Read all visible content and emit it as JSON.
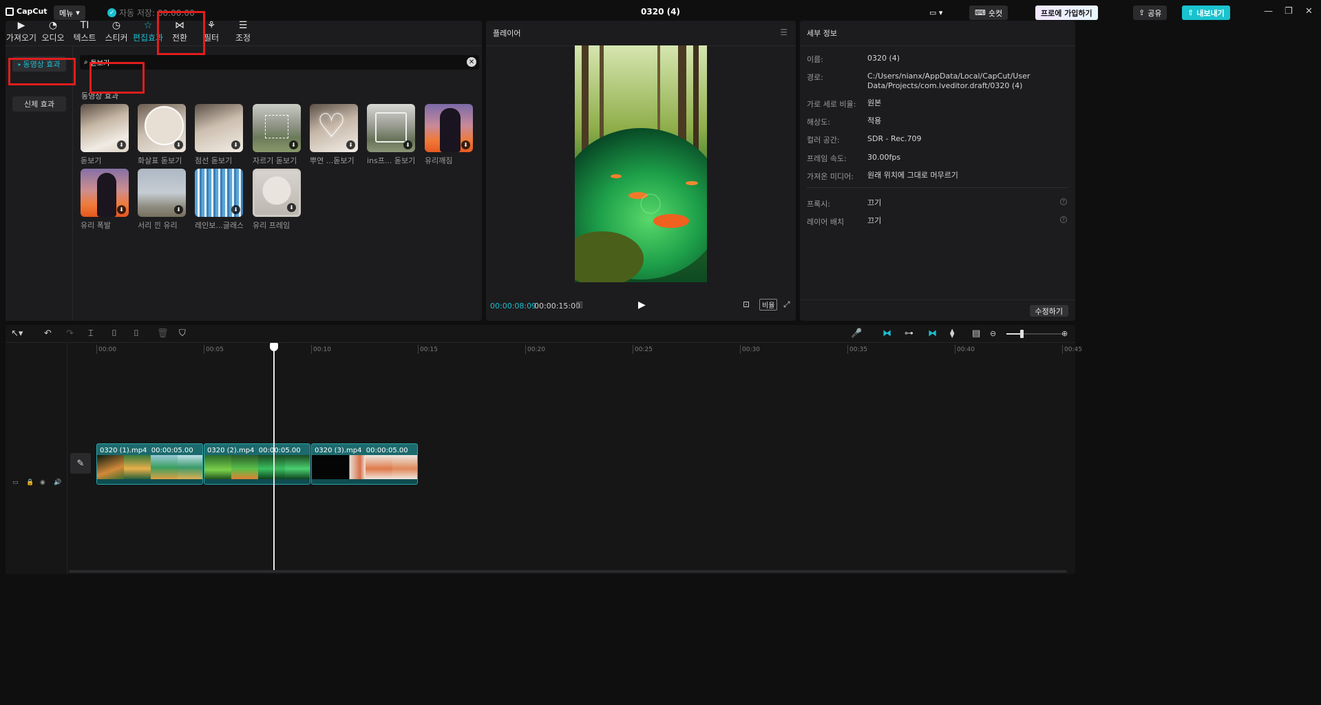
{
  "app": {
    "logo": "CapCut",
    "menu_label": "메뉴",
    "autosave": "자동 저장: 00:00:00",
    "project_title": "0320 (4)"
  },
  "titlebar": {
    "shortcut_label": "숏컷",
    "pro_label": "프로에 가입하기",
    "share_label": "공유",
    "export_label": "내보내기"
  },
  "tabs": [
    {
      "label": "가져오기",
      "icon": "import-icon"
    },
    {
      "label": "오디오",
      "icon": "audio-icon"
    },
    {
      "label": "텍스트",
      "icon": "text-icon"
    },
    {
      "label": "스티커",
      "icon": "sticker-icon"
    },
    {
      "label": "편집효과",
      "icon": "effects-icon"
    },
    {
      "label": "전환",
      "icon": "transition-icon"
    },
    {
      "label": "필터",
      "icon": "filter-icon"
    },
    {
      "label": "조정",
      "icon": "adjust-icon"
    }
  ],
  "sidebar": {
    "items": [
      {
        "label": "동영상 효과"
      },
      {
        "label": "신체 효과"
      }
    ]
  },
  "search": {
    "value": "돋보기"
  },
  "library": {
    "section_title": "동영상 효과",
    "effects": [
      {
        "label": "돋보기"
      },
      {
        "label": "화살표 돋보기"
      },
      {
        "label": "점선 돋보기"
      },
      {
        "label": "자르기 돋보기"
      },
      {
        "label": "뿌연 ...돋보기"
      },
      {
        "label": "ins프... 돋보기"
      },
      {
        "label": "유리깨짐"
      },
      {
        "label": "유리 폭발"
      },
      {
        "label": "서리 낀 유리"
      },
      {
        "label": "레인보...글래스"
      },
      {
        "label": "유리 프레임"
      }
    ]
  },
  "player": {
    "title": "플레이어",
    "current_time": "00:00:08:09",
    "duration": "00:00:15:00",
    "ratio_label": "비율"
  },
  "details": {
    "title": "세부 정보",
    "rows": [
      {
        "key": "이름:",
        "value": "0320 (4)"
      },
      {
        "key": "경로:",
        "value": "C:/Users/nianx/AppData/Local/CapCut/User Data/Projects/com.lveditor.draft/0320 (4)"
      },
      {
        "key": "가로 세로 비율:",
        "value": "원본"
      },
      {
        "key": "해상도:",
        "value": "적용"
      },
      {
        "key": "컬러 공간:",
        "value": "SDR - Rec.709"
      },
      {
        "key": "프레임 속도:",
        "value": "30.00fps"
      },
      {
        "key": "가져온 미디어:",
        "value": "원래 위치에 그대로 머무르기"
      },
      {
        "key": "프록시:",
        "value": "끄기"
      },
      {
        "key": "레이어 배치",
        "value": "끄기"
      }
    ],
    "modify_label": "수정하기"
  },
  "timeline": {
    "ruler": [
      "00:00",
      "00:05",
      "00:10",
      "00:15",
      "00:20",
      "00:25",
      "00:30",
      "00:35",
      "00:40",
      "00:45"
    ],
    "clips": [
      {
        "name": "0320 (1).mp4",
        "duration": "00:00:05.00"
      },
      {
        "name": "0320 (2).mp4",
        "duration": "00:00:05.00"
      },
      {
        "name": "0320 (3).mp4",
        "duration": "00:00:05.00"
      }
    ]
  },
  "colors": {
    "accent": "#1bbfd0",
    "highlight_box": "#e11d1d",
    "clip": "#1c6a6d"
  }
}
